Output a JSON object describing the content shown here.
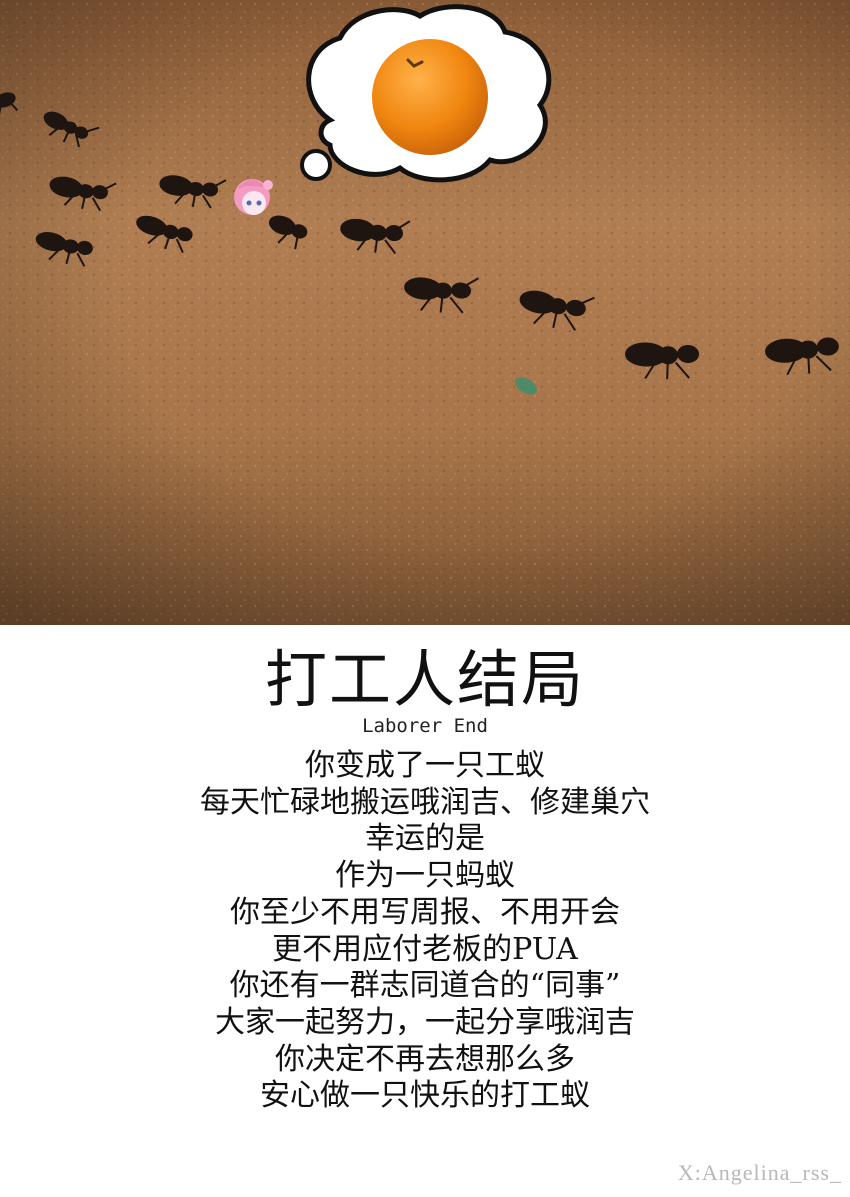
{
  "photo": {
    "scene": "ants marching on sand",
    "thought_bubble_icon": "orange-icon",
    "character_icon": "pink-hair-chibi-icon"
  },
  "heading": {
    "title": "打工人结局",
    "subtitle": "Laborer End"
  },
  "poem": [
    "你变成了一只工蚁",
    "每天忙碌地搬运哦润吉、修建巢穴",
    "幸运的是",
    "作为一只蚂蚁",
    "你至少不用写周报、不用开会",
    "更不用应付老板的PUA",
    "你还有一群志同道合的“同事”",
    "大家一起努力，一起分享哦润吉",
    "你决定不再去想那么多",
    "安心做一只快乐的打工蚁"
  ],
  "watermark": "X:Angelina_rss_",
  "colors": {
    "sand": "#a9764b",
    "orange": "#f0860f",
    "ant": "#1e1410",
    "hair": "#f39bc0"
  }
}
